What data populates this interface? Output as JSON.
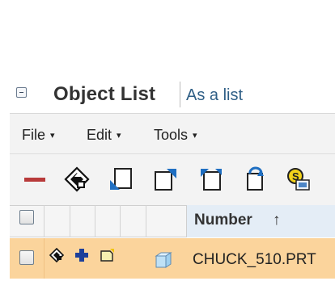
{
  "header": {
    "title": "Object List",
    "view_mode": "As a list"
  },
  "menu": {
    "items": [
      {
        "label": "File"
      },
      {
        "label": "Edit"
      },
      {
        "label": "Tools"
      }
    ],
    "caret": "▾"
  },
  "toolbar": {
    "buttons": [
      {
        "name": "remove-icon"
      },
      {
        "name": "view-object-icon"
      },
      {
        "name": "insert-before-icon"
      },
      {
        "name": "insert-after-icon"
      },
      {
        "name": "insert-child-icon"
      },
      {
        "name": "refresh-icon"
      },
      {
        "name": "workspace-icon"
      }
    ]
  },
  "table": {
    "columns": [
      {
        "label": "Number",
        "sort": "↑"
      }
    ],
    "rows": [
      {
        "number": "CHUCK_510.PRT",
        "status_icons": [
          "object-info-icon",
          "add-icon",
          "new-folder-icon"
        ],
        "type_icon": "part-cube-icon"
      }
    ]
  },
  "colors": {
    "selected_row": "#fbd49c",
    "header_highlight": "#e4edf6",
    "title_text": "#333333",
    "subtitle_text": "#2f5f86"
  }
}
